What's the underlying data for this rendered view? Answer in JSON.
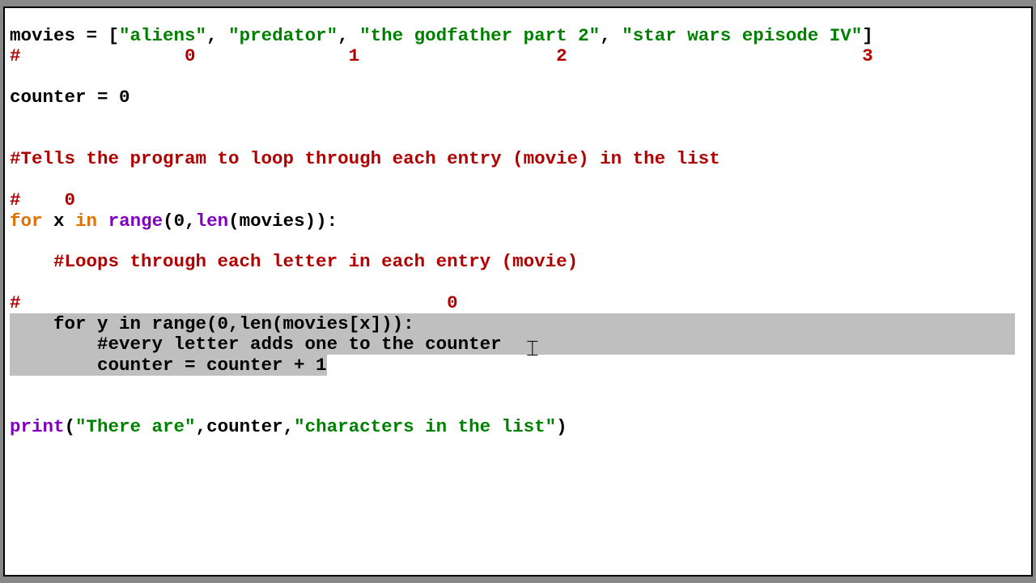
{
  "code": {
    "l1_a": "movies = [",
    "l1_s1": "\"aliens\"",
    "l1_c1": ", ",
    "l1_s2": "\"predator\"",
    "l1_c2": ", ",
    "l1_s3": "\"the godfather part 2\"",
    "l1_c3": ", ",
    "l1_s4": "\"star wars episode IV\"",
    "l1_b": "]",
    "l2": "#               0              1                  2                           3",
    "l4": "counter = 0",
    "l7": "#Tells the program to loop through each entry (movie) in the list",
    "l9": "#    0",
    "l10_for": "for",
    "l10_x": " x ",
    "l10_in": "in",
    "l10_sp": " ",
    "l10_range": "range",
    "l10_a": "(0,",
    "l10_len": "len",
    "l10_b": "(movies)):",
    "l12": "    #Loops through each letter in each entry (movie)",
    "l14_a": "#",
    "l14_b": "                                       0",
    "l15": "    for y in range(0,len(movies[x])):",
    "l16": "        #every letter adds one to the counter",
    "l17": "        counter = counter + 1",
    "l20_print": "print",
    "l20_a": "(",
    "l20_s1": "\"There are\"",
    "l20_c1": ",counter,",
    "l20_s2": "\"characters in the list\"",
    "l20_b": ")"
  },
  "cursor_glyph": "⌶",
  "colors": {
    "keyword": "#e07000",
    "builtin": "#8000c0",
    "string": "#008000",
    "comment": "#B00000",
    "selection": "#bfbfbf"
  }
}
